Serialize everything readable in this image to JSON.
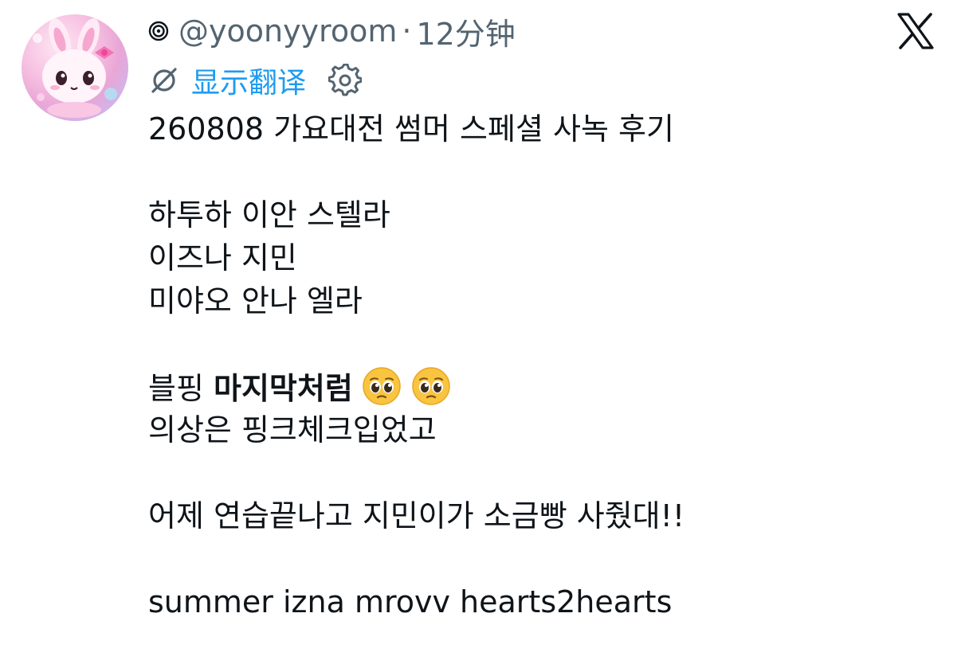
{
  "author": {
    "handle": "@yoonyyroom",
    "separator": "·",
    "time": "12分钟"
  },
  "translate": {
    "label": "显示翻译"
  },
  "post": {
    "line1": "260808 가요대전 썸머 스페셜 사녹 후기",
    "line2": "하투하 이안 스텔라",
    "line3": "이즈나 지민",
    "line4": "미야오 안나 엘라",
    "line5_prefix": "블핑 ",
    "line5_bold": "마지막처럼",
    "line6": "의상은 핑크체크입었고",
    "line7": "어제 연습끝나고 지민이가 소금빵 사줬대!!",
    "line8": "summer izna mrovv hearts2hearts"
  },
  "icons": {
    "community": "spiral-icon",
    "translate": "translate-slash-icon",
    "settings": "gear-icon",
    "brand": "x-logo-icon",
    "emoji": "pleading-face-emoji"
  },
  "colors": {
    "link": "#1d9bf0",
    "secondary": "#536471",
    "text": "#0f1419"
  }
}
